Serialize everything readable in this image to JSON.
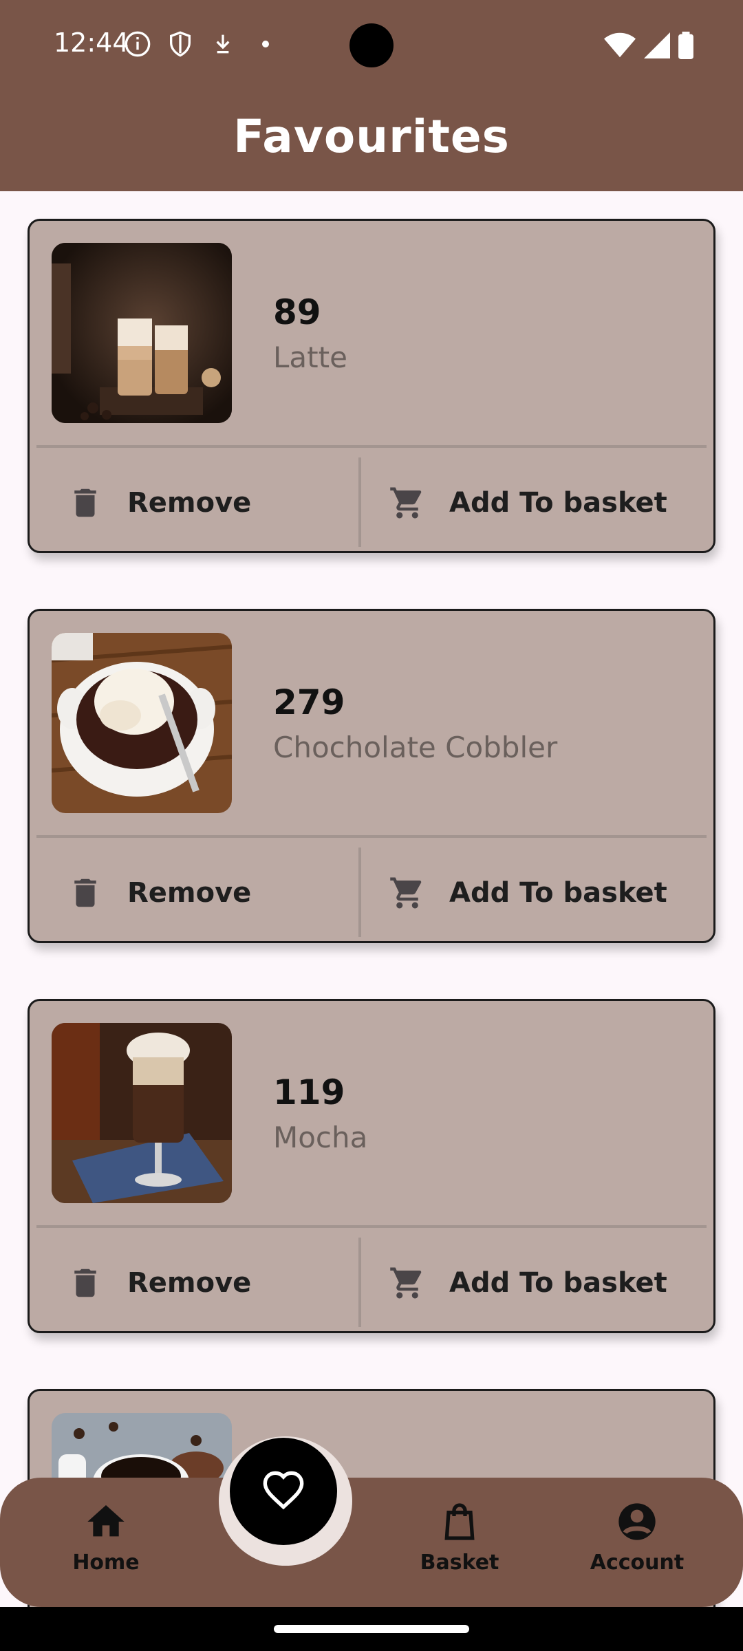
{
  "status_bar": {
    "time": "12:44"
  },
  "header": {
    "title": "Favourites"
  },
  "favourites": [
    {
      "price": "89",
      "name": "Latte",
      "remove_label": "Remove",
      "add_label": "Add To basket",
      "image": "latte-photo"
    },
    {
      "price": "279",
      "name": "Chocholate Cobbler",
      "remove_label": "Remove",
      "add_label": "Add To basket",
      "image": "cobbler-photo"
    },
    {
      "price": "119",
      "name": "Mocha",
      "remove_label": "Remove",
      "add_label": "Add To basket",
      "image": "mocha-photo"
    },
    {
      "price": "",
      "name": "",
      "image": "coffee-cup-photo"
    }
  ],
  "bottom_nav": {
    "items": [
      {
        "label": "Home",
        "icon": "home-icon"
      },
      {
        "label": "Basket",
        "icon": "bag-icon"
      },
      {
        "label": "Account",
        "icon": "account-icon"
      }
    ],
    "fab_icon": "heart-icon"
  },
  "colors": {
    "primary": "#795548",
    "card": "#bcaaa4",
    "background": "#fdf7fb"
  }
}
